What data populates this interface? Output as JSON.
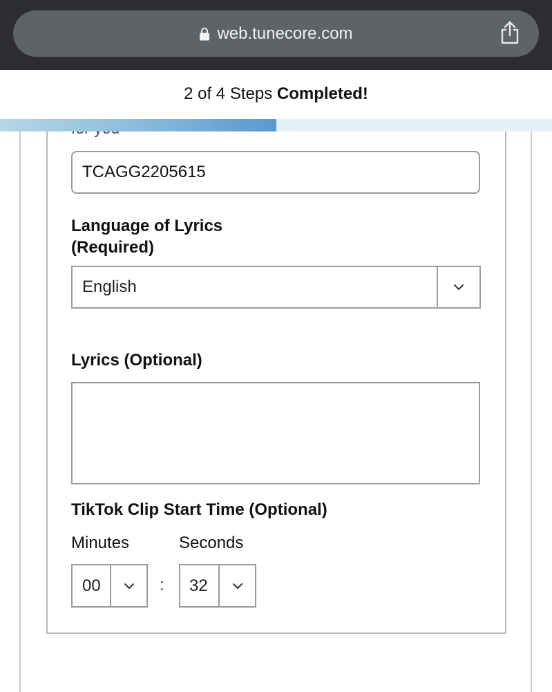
{
  "browser": {
    "url": "web.tunecore.com"
  },
  "progress": {
    "steps_text": "2 of 4 Steps",
    "completed_text": "Completed!",
    "fraction": 0.5
  },
  "form": {
    "cut_off_text": "for you",
    "isrc_value": "TCAGG2205615",
    "language": {
      "label_line1": "Language of Lyrics",
      "label_line2": "(Required)",
      "selected": "English"
    },
    "lyrics": {
      "label": "Lyrics (Optional)",
      "value": ""
    },
    "tiktok": {
      "label": "TikTok Clip Start Time (Optional)",
      "minutes_label": "Minutes",
      "seconds_label": "Seconds",
      "minutes_value": "00",
      "seconds_value": "32",
      "separator": ":"
    }
  },
  "colors": {
    "browser_bar": "#2c2e31",
    "url_pill": "#5f6266",
    "progress_track": "#e3f1f8",
    "progress_fill_end": "#5a98cf"
  }
}
